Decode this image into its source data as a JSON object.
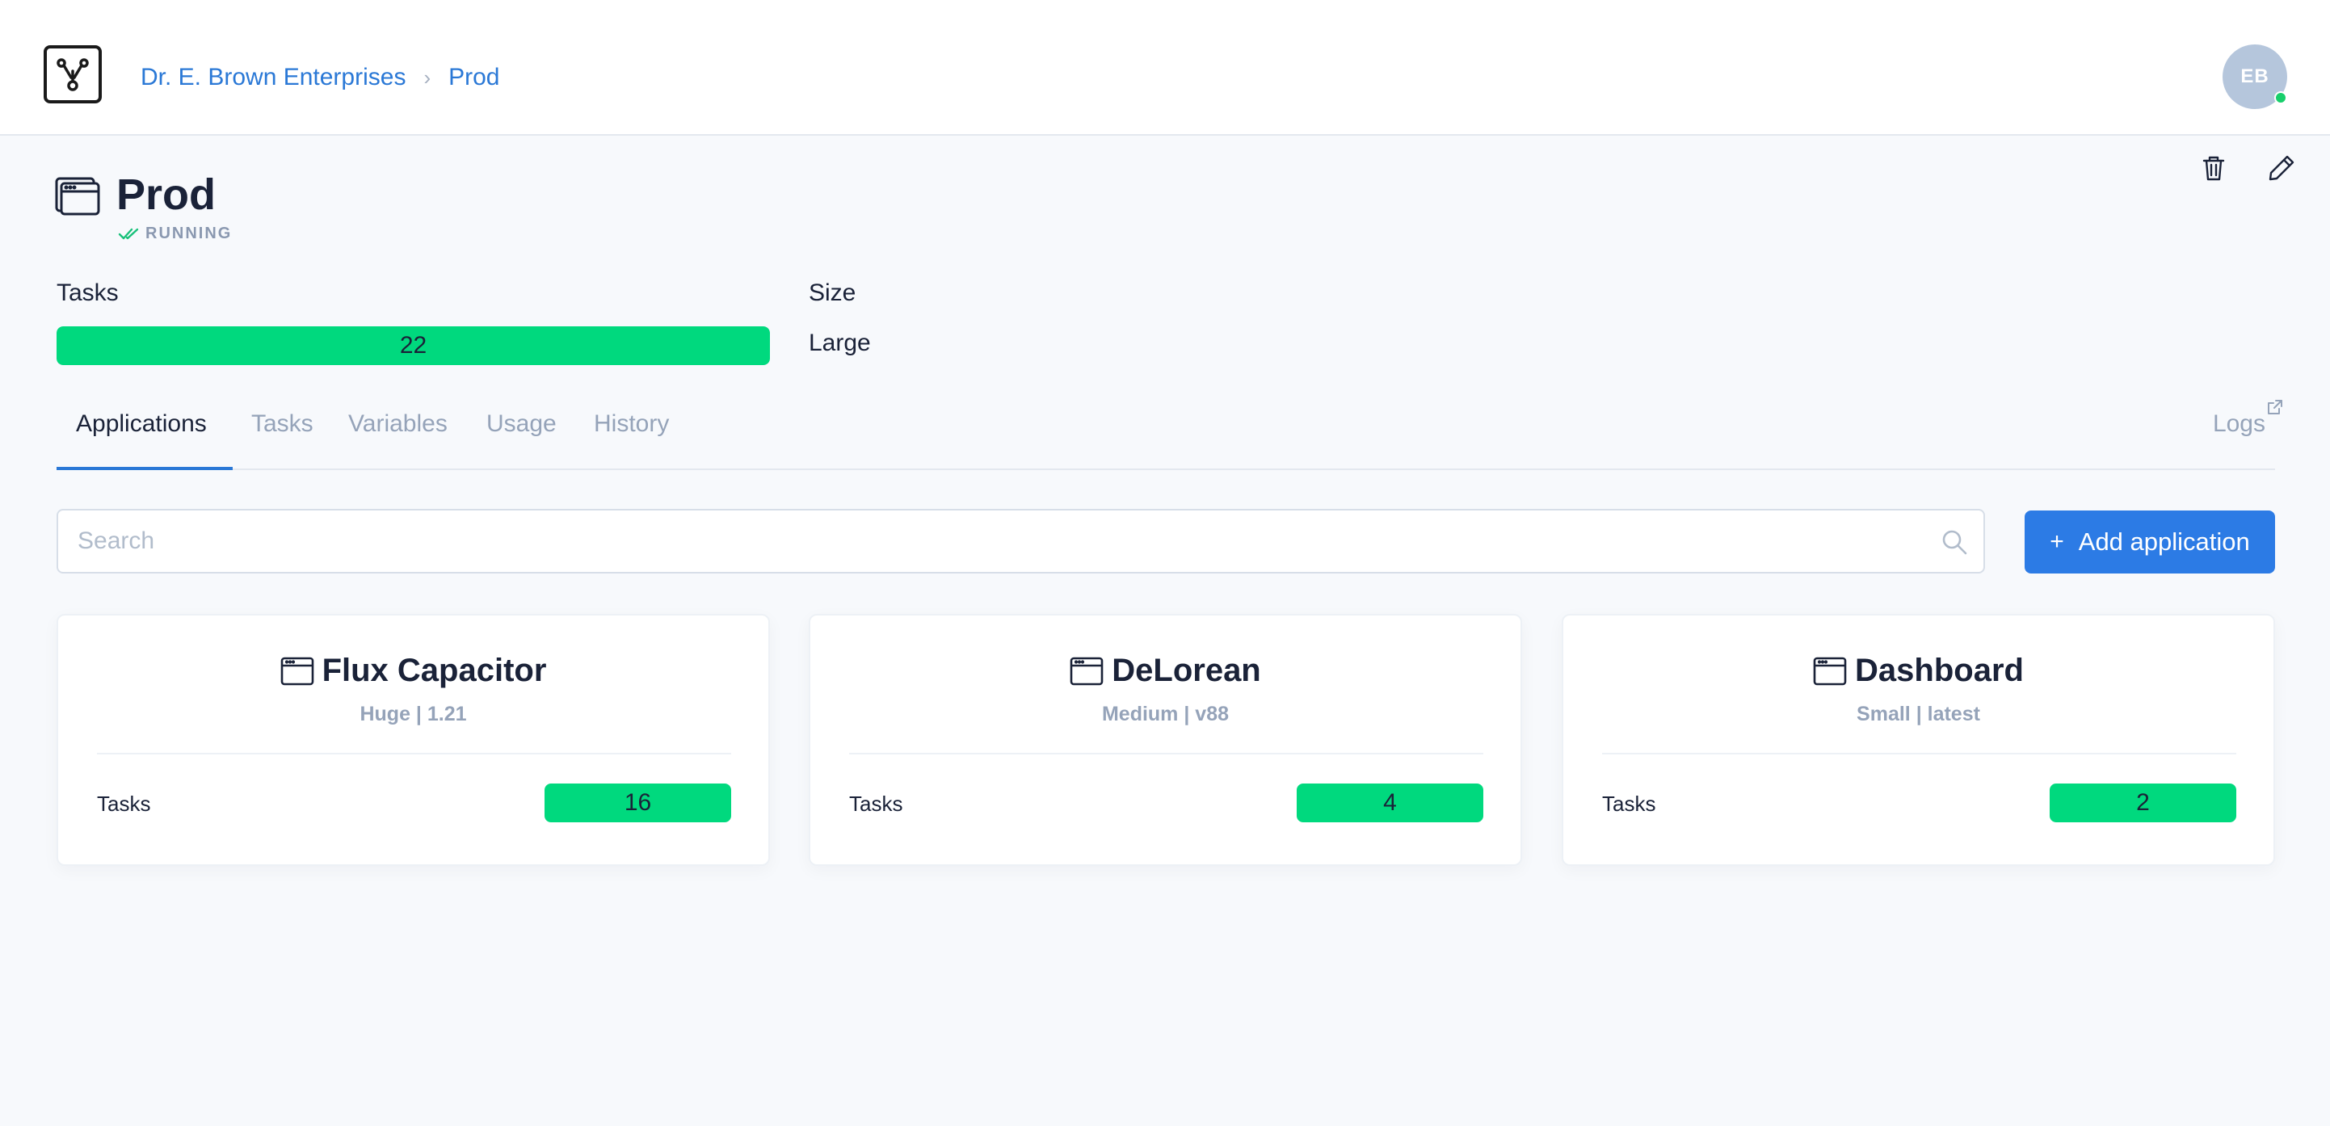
{
  "header": {
    "breadcrumb": [
      "Dr. E. Brown Enterprises",
      "Prod"
    ],
    "avatar_initials": "EB"
  },
  "environment": {
    "title": "Prod",
    "status": "RUNNING",
    "tasks_label": "Tasks",
    "tasks_value": "22",
    "size_label": "Size",
    "size_value": "Large"
  },
  "tabs": [
    {
      "label": "Applications",
      "active": true
    },
    {
      "label": "Tasks",
      "active": false
    },
    {
      "label": "Variables",
      "active": false
    },
    {
      "label": "Usage",
      "active": false
    },
    {
      "label": "History",
      "active": false
    }
  ],
  "logs_label": "Logs",
  "search": {
    "placeholder": "Search"
  },
  "add_button": {
    "label": "Add application"
  },
  "applications": [
    {
      "name": "Flux Capacitor",
      "subtitle": "Huge | 1.21",
      "tasks_label": "Tasks",
      "tasks_value": "16"
    },
    {
      "name": "DeLorean",
      "subtitle": "Medium | v88",
      "tasks_label": "Tasks",
      "tasks_value": "4"
    },
    {
      "name": "Dashboard",
      "subtitle": "Small | latest",
      "tasks_label": "Tasks",
      "tasks_value": "2"
    }
  ],
  "colors": {
    "accent": "#2c7be5",
    "success": "#00d97e",
    "muted": "#95a3b9",
    "background": "#f7f9fc"
  },
  "icons": [
    "logo-icon",
    "trash-icon",
    "pencil-icon",
    "window-icon",
    "check-double-icon",
    "external-link-icon",
    "search-icon",
    "plus-icon"
  ]
}
